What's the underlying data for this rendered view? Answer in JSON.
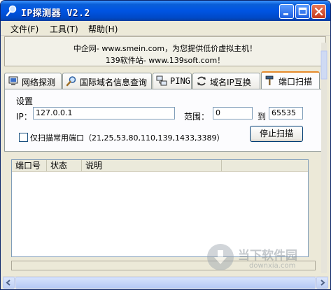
{
  "window": {
    "title": "IP探测器 V2.2"
  },
  "menu": {
    "file": "文件(F)",
    "tools": "工具(T)",
    "help": "帮助(H)"
  },
  "banner": {
    "line1": "中企网- www.smein.com，为您提供低价虚拟主机！",
    "line2": "139软件站- www.139soft.com！"
  },
  "tabs": [
    {
      "label": "网络探测",
      "icon": "computer-icon"
    },
    {
      "label": "国际域名信息查询",
      "icon": "magnifier-icon"
    },
    {
      "label": "PING",
      "icon": "network-icon"
    },
    {
      "label": "域名IP互换",
      "icon": "swap-icon"
    },
    {
      "label": "端口扫描",
      "icon": "hammer-icon",
      "active": true
    }
  ],
  "settings": {
    "group_title": "设置",
    "ip_label": "IP：",
    "ip_value": "127.0.0.1",
    "range_label": "范围：",
    "range_from": "0",
    "range_to_label": "到",
    "range_to": "65535",
    "common_ports_label": "仅扫描常用端口（21,25,53,80,110,139,1433,3389）",
    "common_ports_checked": false,
    "stop_button": "停止扫描"
  },
  "results": {
    "columns": [
      "端口号",
      "状态",
      "说明"
    ]
  },
  "watermark": {
    "text": "当下软件园",
    "sub": "downxia.com"
  },
  "colors": {
    "title_bar": "#0054e3",
    "tab_active_accent": "#e68b2c",
    "window_bg": "#ece9d8"
  }
}
